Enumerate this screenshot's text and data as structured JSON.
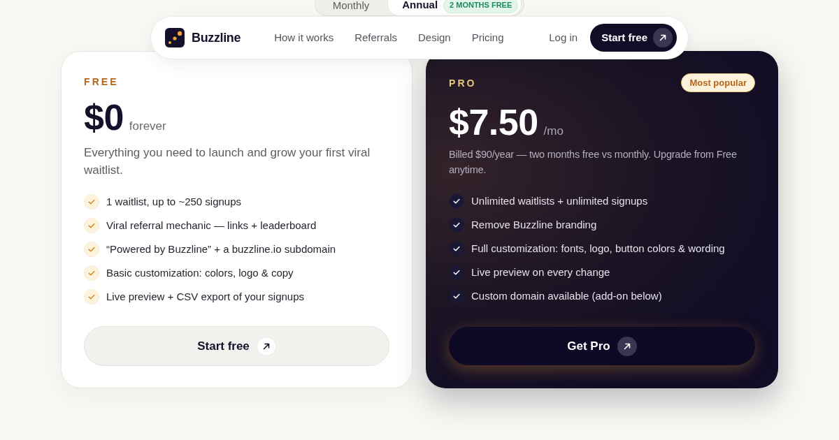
{
  "billing_toggle": {
    "options": [
      {
        "label": "Monthly",
        "selected": false
      },
      {
        "label": "Annual",
        "selected": true,
        "badge": "2 MONTHS FREE"
      }
    ]
  },
  "nav": {
    "brand": "Buzzline",
    "links": [
      "How it works",
      "Referrals",
      "Design",
      "Pricing"
    ],
    "login": "Log in",
    "cta": "Start free"
  },
  "plans": [
    {
      "kind": "free",
      "name": "FREE",
      "price": "$0",
      "period": "forever",
      "description": "Everything you need to launch and grow your first viral waitlist.",
      "features": [
        "1 waitlist, up to ~250 signups",
        "Viral referral mechanic — links + leaderboard",
        "“Powered by Buzzline” + a buzzline.io subdomain",
        "Basic customization: colors, logo & copy",
        "Live preview + CSV export of your signups"
      ],
      "button": "Start free"
    },
    {
      "kind": "pro",
      "name": "PRO",
      "badge": "Most popular",
      "price": "$7.50",
      "period": "/mo",
      "description": "Billed $90/year — two months free vs monthly. Upgrade from Free anytime.",
      "features": [
        "Unlimited waitlists + unlimited signups",
        "Remove Buzzline branding",
        "Full customization: fonts, logo, button colors & wording",
        "Live preview on every change",
        "Custom domain available (add-on below)"
      ],
      "button": "Get Pro"
    }
  ]
}
